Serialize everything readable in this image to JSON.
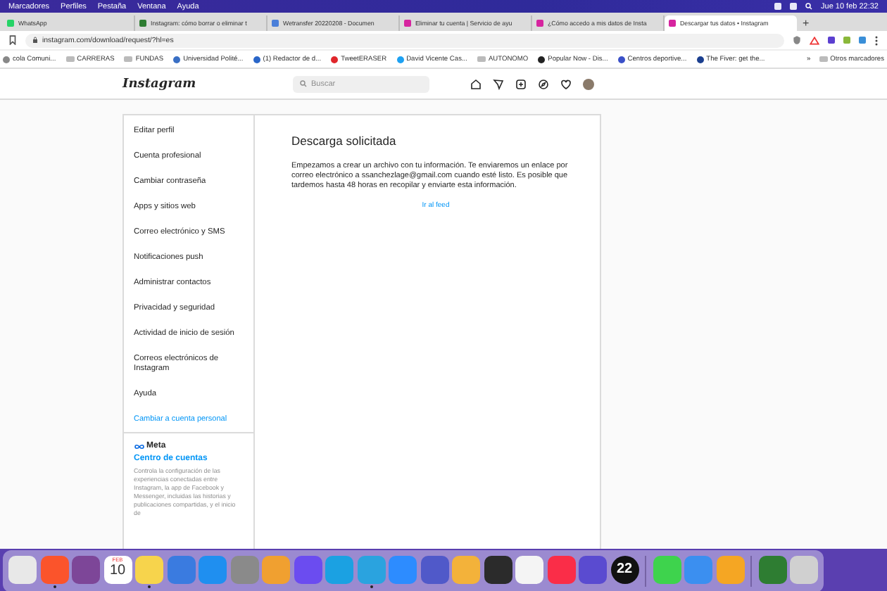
{
  "menubar": {
    "items": [
      "Marcadores",
      "Perfiles",
      "Pestaña",
      "Ventana",
      "Ayuda"
    ],
    "clock": "Jue 10 feb  22:32"
  },
  "tabs": [
    {
      "title": "WhatsApp",
      "selected": false,
      "color": "#25d366"
    },
    {
      "title": "Instagram: cómo borrar o eliminar t",
      "selected": false,
      "color": "#2e7d32"
    },
    {
      "title": "Wetransfer 20220208 - Documen",
      "selected": false,
      "color": "#4a7fd9"
    },
    {
      "title": "Eliminar tu cuenta | Servicio de ayu",
      "selected": false,
      "color": "#d6249f"
    },
    {
      "title": "¿Cómo accedo a mis datos de Insta",
      "selected": false,
      "color": "#d6249f"
    },
    {
      "title": "Descargar tus datos • Instagram",
      "selected": true,
      "color": "#d6249f"
    }
  ],
  "new_tab": "+",
  "address": {
    "url": "instagram.com/download/request/?hl=es"
  },
  "bookmarks": [
    {
      "kind": "site",
      "label": "cola Comuni...",
      "color": "#888888"
    },
    {
      "kind": "folder",
      "label": "CARRERAS"
    },
    {
      "kind": "folder",
      "label": "FUNDAS"
    },
    {
      "kind": "site",
      "label": "Universidad Polité...",
      "color": "#3a6fc4"
    },
    {
      "kind": "site",
      "label": "(1) Redactor de d...",
      "color": "#2a66c8"
    },
    {
      "kind": "site",
      "label": "TweetERASER",
      "color": "#e0262b"
    },
    {
      "kind": "site",
      "label": "David Vicente Cas...",
      "color": "#1da1f2"
    },
    {
      "kind": "folder",
      "label": "AUTONOMO"
    },
    {
      "kind": "site",
      "label": "Popular Now - Dis...",
      "color": "#222222"
    },
    {
      "kind": "site",
      "label": "Centros deportive...",
      "color": "#3a50c8"
    },
    {
      "kind": "site",
      "label": "The Fiver: get the...",
      "color": "#1b3f8f"
    }
  ],
  "bookmarks_more": "»",
  "other_bookmarks": "Otros marcadores",
  "instagram": {
    "logo": "Instagram",
    "search": {
      "placeholder": "Buscar"
    }
  },
  "sidebar": {
    "items": [
      {
        "label": "Editar perfil",
        "selected": false
      },
      {
        "label": "Cuenta profesional",
        "selected": false
      },
      {
        "label": "Cambiar contraseña",
        "selected": false
      },
      {
        "label": "Apps y sitios web",
        "selected": false
      },
      {
        "label": "Correo electrónico y SMS",
        "selected": false
      },
      {
        "label": "Notificaciones push",
        "selected": false
      },
      {
        "label": "Administrar contactos",
        "selected": false
      },
      {
        "label": "Privacidad y seguridad",
        "selected": false
      },
      {
        "label": "Actividad de inicio de sesión",
        "selected": false
      },
      {
        "label": "Correos electrónicos de Instagram",
        "selected": false
      },
      {
        "label": "Ayuda",
        "selected": false
      }
    ],
    "switch_link": "Cambiar a cuenta personal",
    "meta": {
      "logo": "Meta",
      "link": "Centro de cuentas",
      "description": "Controla la configuración de las experiencias conectadas entre Instagram, la app de Facebook y Messenger, incluidas las historias y publicaciones compartidas, y el inicio de"
    }
  },
  "main": {
    "title": "Descarga solicitada",
    "message": "Empezamos a crear un archivo con tu información. Te enviaremos un enlace por correo electrónico a ssanchezlage@gmail.com cuando esté listo. Es posible que tardemos hasta 48 horas en recopilar y enviarte esta información.",
    "link": "Ir al feed"
  },
  "dock": [
    {
      "kind": "app",
      "color": "#e8e8e8",
      "running": false
    },
    {
      "kind": "app",
      "color": "#fb542b",
      "running": true
    },
    {
      "kind": "app",
      "color": "#7d4698",
      "running": false
    },
    {
      "kind": "calendar",
      "month": "FEB",
      "day": "10",
      "running": false
    },
    {
      "kind": "app",
      "color": "#f7d44c",
      "running": true
    },
    {
      "kind": "app",
      "color": "#3a7be0",
      "running": false
    },
    {
      "kind": "app",
      "color": "#1f8ff0",
      "running": false
    },
    {
      "kind": "app",
      "color": "#8a8a8a",
      "running": false
    },
    {
      "kind": "app",
      "color": "#f0a030",
      "running": false
    },
    {
      "kind": "app",
      "color": "#6b4cf0",
      "running": false
    },
    {
      "kind": "app",
      "color": "#1ba1e2",
      "running": false
    },
    {
      "kind": "app",
      "color": "#2aa3df",
      "running": true
    },
    {
      "kind": "app",
      "color": "#2d8cff",
      "running": false
    },
    {
      "kind": "app",
      "color": "#5059c9",
      "running": false
    },
    {
      "kind": "app",
      "color": "#f3b23a",
      "running": false
    },
    {
      "kind": "app",
      "color": "#2b2b2b",
      "running": false
    },
    {
      "kind": "app",
      "color": "#f4f4f4",
      "running": false
    },
    {
      "kind": "app",
      "color": "#fa2d48",
      "running": false
    },
    {
      "kind": "app",
      "color": "#5a4bd0",
      "running": false
    },
    {
      "kind": "text",
      "text": "22",
      "color": "#111111",
      "running": false
    },
    {
      "kind": "divider"
    },
    {
      "kind": "app",
      "color": "#3ed34d",
      "running": false
    },
    {
      "kind": "app",
      "color": "#3b8ff0",
      "running": false
    },
    {
      "kind": "app",
      "color": "#f5a623",
      "running": false
    },
    {
      "kind": "divider"
    },
    {
      "kind": "app",
      "color": "#2e7d32",
      "running": false
    },
    {
      "kind": "app",
      "color": "#d0d0d0",
      "running": false
    }
  ]
}
